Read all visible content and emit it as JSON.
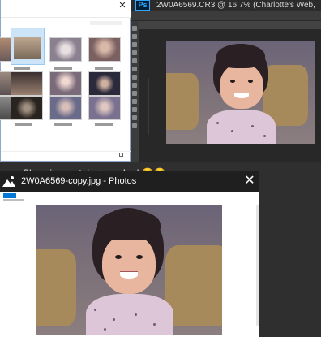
{
  "photoshop": {
    "app_logo": "Ps",
    "document_title": "2W0A6569.CR3 @ 16.7% (Charlotte's Web,"
  },
  "chat": {
    "message_text": "Show is great, just cracked 😎😎"
  },
  "photos_app": {
    "window_title": "2W0A6569-copy.jpg - Photos",
    "close_label": "✕"
  },
  "explorer": {
    "close_label": "✕",
    "thumbnails": [
      {
        "name": "thumb-1",
        "tone": "#7a6a5a"
      },
      {
        "name": "thumb-2",
        "tone": "#d4cfcf",
        "selected": true
      },
      {
        "name": "thumb-3",
        "tone": "#8a7e6a"
      },
      {
        "name": "thumb-4",
        "tone": "#9a8a8a"
      },
      {
        "name": "thumb-5",
        "tone": "#a8a090"
      },
      {
        "name": "thumb-6",
        "tone": "#6a5a70"
      },
      {
        "name": "thumb-7",
        "tone": "#3a3a48"
      },
      {
        "name": "thumb-8",
        "tone": "#5a5058"
      },
      {
        "name": "thumb-9",
        "tone": "#4a4660"
      },
      {
        "name": "thumb-10",
        "tone": "#8a7a78"
      },
      {
        "name": "thumb-11",
        "tone": "#7a6a8a"
      },
      {
        "name": "thumb-12",
        "tone": "#6a6a80"
      }
    ]
  },
  "colors": {
    "photoshop_accent": "#31a8ff",
    "photos_accent": "#0078d7",
    "selection": "#cce4f7"
  }
}
